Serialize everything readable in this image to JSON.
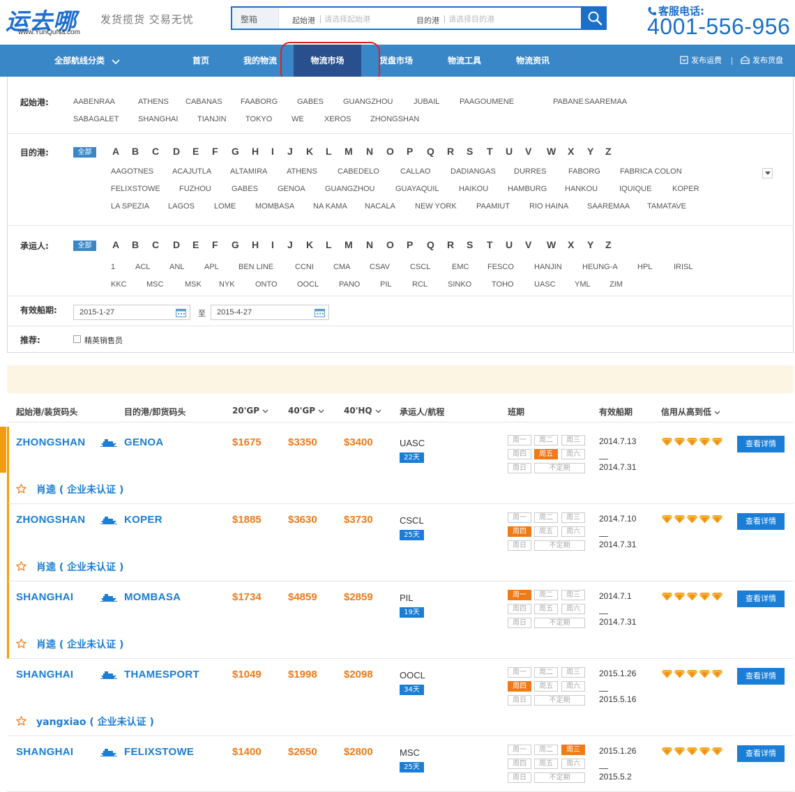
{
  "header": {
    "logo_text": "运去哪",
    "logo_domain": "www.YunQuNa.com",
    "slogan": "发货揽货 交易无忧",
    "search": {
      "type_label": "整箱",
      "origin_label": "起始港",
      "origin_placeholder": "请选择起始港",
      "dest_label": "目的港",
      "dest_placeholder": "请选择目的港",
      "button_icon": "search-icon"
    },
    "hotline_label": "客服电话:",
    "hotline_number": "4001-556-956"
  },
  "nav": {
    "all_routes": "全部航线分类",
    "items": [
      "首页",
      "我的物流",
      "物流市场",
      "货盘市场",
      "物流工具",
      "物流资讯"
    ],
    "active_index": 2,
    "publish_freight": "发布运费",
    "publish_cargo": "发布货盘"
  },
  "filters": {
    "origin": {
      "label": "起始港:",
      "options": [
        "AABENRAA",
        "ATHENS",
        "CABANAS",
        "FAABORG",
        "GABES",
        "GUANGZHOU",
        "JUBAIL",
        "PAAGOUMENE",
        "PABANE",
        "SAAREMAA",
        "SABAGALET",
        "SHANGHAI",
        "TIANJIN",
        "TOKYO",
        "WE",
        "XEROS",
        "ZHONGSHAN"
      ]
    },
    "destination": {
      "label": "目的港:",
      "all_label": "全部",
      "letters": [
        "A",
        "B",
        "C",
        "D",
        "E",
        "F",
        "G",
        "H",
        "I",
        "J",
        "K",
        "L",
        "M",
        "N",
        "O",
        "P",
        "Q",
        "R",
        "S",
        "T",
        "U",
        "V",
        "W",
        "X",
        "Y",
        "Z"
      ],
      "options": [
        "AAGOTNES",
        "ACAJUTLA",
        "ALTAMIRA",
        "ATHENS",
        "CABEDELO",
        "CALLAO",
        "DADIANGAS",
        "DURRES",
        "FABORG",
        "FABRICA COLON",
        "FELIXSTOWE",
        "FUZHOU",
        "GABES",
        "GENOA",
        "GUANGZHOU",
        "GUAYAQUIL",
        "HAIKOU",
        "HAMBURG",
        "HANKOU",
        "IQUIQUE",
        "KOPER",
        "LA SPEZIA",
        "LAGOS",
        "LOME",
        "MOMBASA",
        "NA KAMA",
        "NACALA",
        "NEW YORK",
        "PAAMIUT",
        "RIO HAINA",
        "SAAREMAA",
        "TAMATAVE"
      ]
    },
    "carrier": {
      "label": "承运人:",
      "all_label": "全部",
      "letters": [
        "A",
        "B",
        "C",
        "D",
        "E",
        "F",
        "G",
        "H",
        "I",
        "J",
        "K",
        "L",
        "M",
        "N",
        "O",
        "P",
        "Q",
        "R",
        "S",
        "T",
        "U",
        "V",
        "W",
        "X",
        "Y",
        "Z"
      ],
      "options": [
        "1",
        "ACL",
        "ANL",
        "APL",
        "BEN LINE",
        "CCNI",
        "CMA",
        "CSAV",
        "CSCL",
        "EMC",
        "FESCO",
        "HANJIN",
        "HEUNG-A",
        "HPL",
        "IRISL",
        "KKC",
        "MSC",
        "MSK",
        "NYK",
        "ONTO",
        "OOCL",
        "PANO",
        "PIL",
        "RCL",
        "SINKO",
        "TOHO",
        "UASC",
        "YML",
        "ZIM"
      ]
    },
    "validity": {
      "label": "有效船期:",
      "from": "2015-1-27",
      "to_label": "至",
      "to": "2015-4-27"
    },
    "recommend": {
      "label": "推荐:",
      "checkbox_label": "精英销售员",
      "checked": false
    }
  },
  "table": {
    "headers": {
      "origin": "起始港/装货码头",
      "dest": "目的港/卸货码头",
      "gp20": "20'GP",
      "gp40": "40'GP",
      "hq40": "40'HQ",
      "carrier": "承运人/航程",
      "schedule": "班期",
      "validity": "有效船期",
      "credit": "信用从高到低"
    },
    "weekdays": [
      "周一",
      "周二",
      "周三",
      "周四",
      "周五",
      "周六",
      "周日",
      "不定期"
    ],
    "detail_label": "查看详情",
    "rows": [
      {
        "origin": "ZHONGSHAN",
        "dest": "GENOA",
        "gp20": "$1675",
        "gp40": "$3350",
        "hq40": "$3400",
        "carrier": "UASC",
        "days": "22天",
        "active_day": 4,
        "valid_from": "2014.7.13",
        "valid_to": "2014.7.31",
        "diamonds": 5,
        "company": "肖逵 ( 企业未认证 )",
        "highlighted": true
      },
      {
        "origin": "ZHONGSHAN",
        "dest": "KOPER",
        "gp20": "$1885",
        "gp40": "$3630",
        "hq40": "$3730",
        "carrier": "CSCL",
        "days": "25天",
        "active_day": 3,
        "valid_from": "2014.7.10",
        "valid_to": "2014.7.31",
        "diamonds": 5,
        "company": "肖逵 ( 企业未认证 )",
        "highlighted": true
      },
      {
        "origin": "SHANGHAI",
        "dest": "MOMBASA",
        "gp20": "$1734",
        "gp40": "$4859",
        "hq40": "$2859",
        "carrier": "PIL",
        "days": "19天",
        "active_day": 0,
        "valid_from": "2014.7.1",
        "valid_to": "2014.7.31",
        "diamonds": 5,
        "company": "肖逵 ( 企业未认证 )",
        "highlighted": true
      },
      {
        "origin": "SHANGHAI",
        "dest": "THAMESPORT",
        "gp20": "$1049",
        "gp40": "$1998",
        "hq40": "$2098",
        "carrier": "OOCL",
        "days": "34天",
        "active_day": 3,
        "valid_from": "2015.1.26",
        "valid_to": "2015.5.16",
        "diamonds": 5,
        "company": "yangxiao ( 企业未认证 )",
        "highlighted": false
      },
      {
        "origin": "SHANGHAI",
        "dest": "FELIXSTOWE",
        "gp20": "$1400",
        "gp40": "$2650",
        "hq40": "$2800",
        "carrier": "MSC",
        "days": "25天",
        "active_day": 2,
        "valid_from": "2015.1.26",
        "valid_to": "2015.5.2",
        "diamonds": 5,
        "company": "",
        "highlighted": false
      }
    ]
  },
  "colors": {
    "brand_blue": "#1a7dd6",
    "nav_blue": "#3a87c7",
    "nav_active": "#294f8c",
    "price_orange": "#f07a17",
    "highlight_circle": "#e02020"
  }
}
